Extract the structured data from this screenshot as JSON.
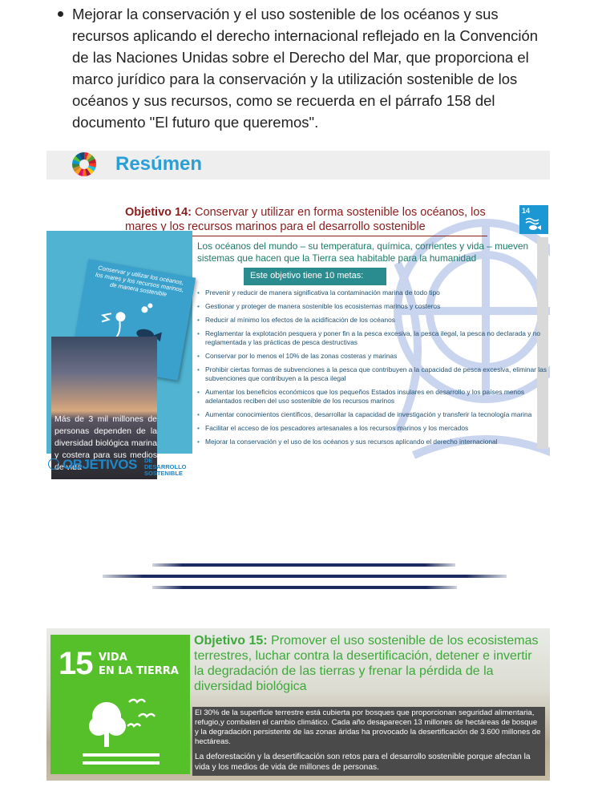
{
  "bullet": {
    "text": "Mejorar la conservación y el uso sostenible de los océanos y sus recursos aplicando el derecho internacional reflejado en la Convención de las Naciones Unidas sobre el Derecho del Mar, que proporciona el marco jurídico para la conservación y la utilización sostenible de los océanos y sus recursos, como se recuerda en el párrafo 158 del documento \"El futuro que queremos\"."
  },
  "resumen": {
    "title": "Resúmen",
    "icon": "sdg-wheel-icon"
  },
  "objetivo14": {
    "label": "Objetivo 14:",
    "title": "Conservar y utilizar en forma sostenible los océanos, los mares y los recursos marinos para el desarrollo sostenible",
    "badge_number": "14",
    "intro": "Los océanos del mundo – su temperatura, química, corrientes y vida – mueven sistemas que hacen que la Tierra sea habitable para la humanidad",
    "metas_label": "Este objetivo tiene 10 metas:",
    "card_text": "Conservar y utilizar los océanos, los mares y los recursos marinos, de manera sostenible",
    "photo_caption": "Más de 3 mil millones de personas dependen de la diversidad biológica marina y costera para sus medios de vida",
    "logo_word": "OBJETIVOS",
    "logo_sub_1": "DE DESARROLLO",
    "logo_sub_2": "SOSTENIBLE",
    "goals": [
      "Prevenir y reducir de manera significativa la contaminación marina de todo tipo",
      "Gestionar y proteger de manera sostenible los ecosistemas marinos y costeros",
      "Reducir al mínimo los efectos de la acidificación de los océanos",
      "Reglamentar la explotación pesquera y poner fin a la pesca excesiva, la pesca ilegal, la pesca no declarada y no reglamentada y las prácticas de pesca destructivas",
      "Conservar por lo menos el 10% de las zonas costeras y marinas",
      "Prohibir ciertas formas de subvenciones a la pesca que contribuyen a la capacidad de pesca excesiva, eliminar las subvenciones que contribuyen a la pesca ilegal",
      "Aumentar los beneficios económicos que los pequeños Estados insulares en desarrollo y los países menos adelantados reciben del uso sostenible de los recursos marinos",
      "Aumentar conocimientos científicos, desarrollar la capacidad de investigación y transferir la tecnología marina",
      "Facilitar el acceso de los pescadores artesanales a los recursos marinos y los mercados",
      "Mejorar la conservación y el uso de los océanos y sus recursos aplicando el derecho internacional"
    ]
  },
  "objetivo15": {
    "tile_number": "15",
    "tile_label_1": "VIDA",
    "tile_label_2": "EN LA TIERRA",
    "label": "Objetivo 15:",
    "title": "Promover el uso sostenible de los ecosistemas terrestres, luchar contra la desertificación, detener e invertir la degradación de las tierras y frenar la pérdida de la diversidad biológica",
    "paragraph1": "El 30% de la superficie terrestre está cubierta por bosques que  proporcionan seguridad alimentaria, refugio,y combaten el cambio climático. Cada año desaparecen 13 millones de hectáreas de bosque y la degradación persistente de las zonas áridas ha provocado la desertificación de 3.600 millones de hectáreas.",
    "paragraph2": "La deforestación y la desertificación son retos para el desarrollo sostenible porque afectan la vida y los medios de vida de millones de personas."
  },
  "colors": {
    "accent_blue": "#2a9fd6",
    "goal14_blue": "#1b97d4",
    "goal15_green": "#56c02b",
    "title14_red": "#8a1c1c",
    "teal": "#2a8c8f"
  }
}
